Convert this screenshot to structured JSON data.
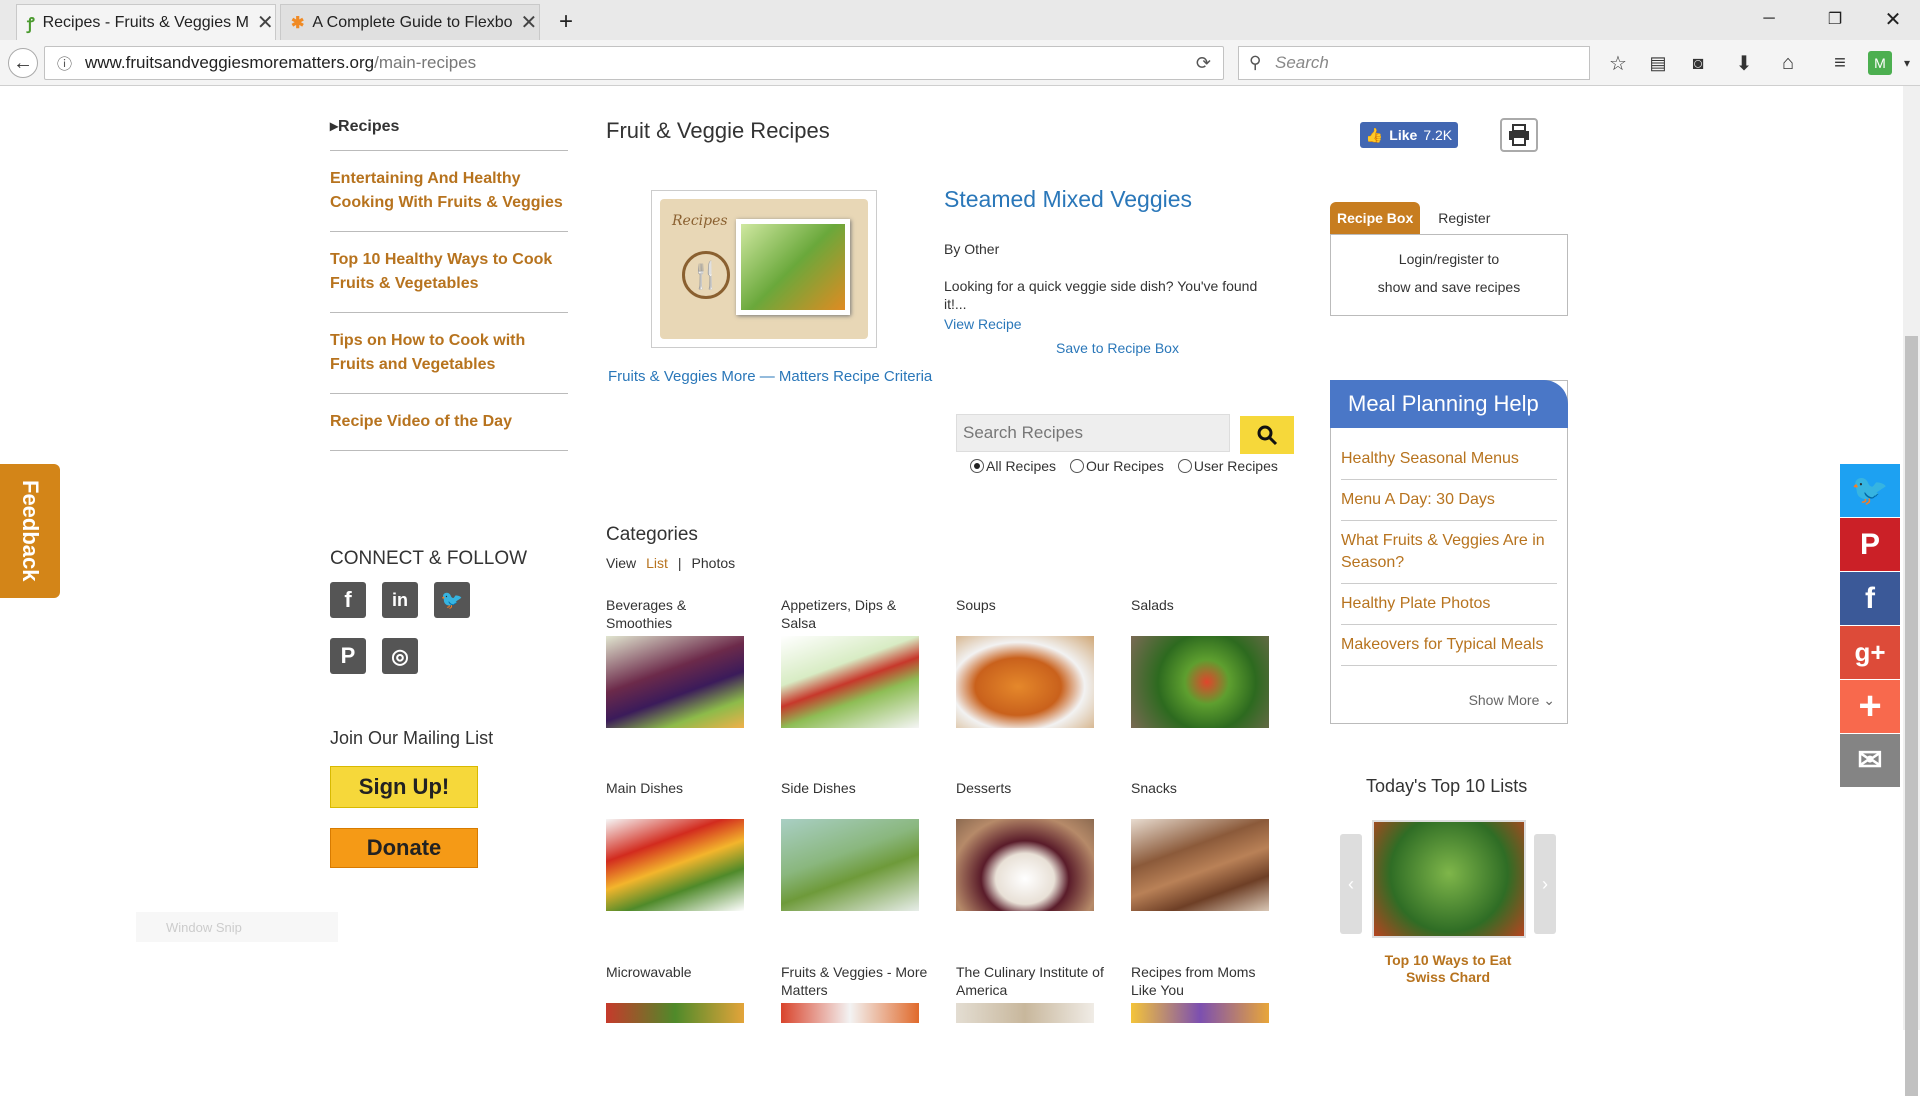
{
  "browser": {
    "tabs": [
      {
        "title": "Recipes - Fruits & Veggies M",
        "active": true
      },
      {
        "title": "A Complete Guide to Flexbo",
        "active": false
      }
    ],
    "new_tab": "+",
    "url_host": "www.fruitsandveggiesmorematters.org",
    "url_path": "/main-recipes",
    "search_placeholder": "Search"
  },
  "left_nav": {
    "head": "Recipes",
    "items": [
      "Entertaining And Healthy Cooking With Fruits & Veggies",
      "Top 10 Healthy Ways to Cook Fruits & Vegetables",
      "Tips on How to Cook with Fruits and Vegetables",
      "Recipe Video of the Day"
    ]
  },
  "connect": {
    "head": "CONNECT & FOLLOW",
    "icons": [
      "facebook-icon",
      "linkedin-icon",
      "twitter-icon",
      "pinterest-icon",
      "instagram-icon"
    ]
  },
  "mailing": {
    "head": "Join Our Mailing List",
    "signup": "Sign Up!",
    "donate": "Donate"
  },
  "feedback": "Feedback",
  "snip_label": "Window Snip",
  "main": {
    "title": "Fruit & Veggie Recipes",
    "recipe_card_script": "Recipes",
    "criteria_link": "Fruits & Veggies More — Matters Recipe Criteria",
    "featured": {
      "title": "Steamed Mixed Veggies",
      "by": "By Other",
      "desc": "Looking for a quick veggie side dish? You've found it!...",
      "view": "View Recipe",
      "save": "Save to Recipe Box"
    },
    "search_placeholder": "Search Recipes",
    "radios": [
      {
        "label": "All Recipes",
        "checked": true
      },
      {
        "label": "Our Recipes",
        "checked": false
      },
      {
        "label": "User Recipes",
        "checked": false
      }
    ],
    "categories_head": "Categories",
    "view_label": "View",
    "view_list": "List",
    "view_sep": "|",
    "view_photos": "Photos",
    "categories": [
      "Beverages & Smoothies",
      "Appetizers, Dips & Salsa",
      "Soups",
      "Salads",
      "Main Dishes",
      "Side Dishes",
      "Desserts",
      "Snacks",
      "Microwavable",
      "Fruits & Veggies - More Matters",
      "The Culinary Institute of America",
      "Recipes from Moms Like You"
    ]
  },
  "right": {
    "like": "Like",
    "like_count": "7.2K",
    "recipe_box_tab": "Recipe Box",
    "register_tab": "Register",
    "recipe_box_text_1": "Login/register to",
    "recipe_box_text_2": "show and save recipes",
    "meal_head": "Meal Planning Help",
    "meal_items": [
      "Healthy Seasonal Menus",
      "Menu A Day: 30 Days",
      "What Fruits & Veggies Are in Season?",
      "Healthy Plate Photos",
      "Makeovers for Typical Meals"
    ],
    "show_more": "Show More",
    "top10_head": "Today's Top 10 Lists",
    "top10_caption": "Top 10 Ways to Eat Swiss Chard"
  },
  "colors": {
    "accent_orange": "#b7731e",
    "link_blue": "#2a77b9",
    "meal_blue": "#4a77c7",
    "twitter": "#1da1f2",
    "pinterest": "#cb2027",
    "facebook": "#3b5998",
    "googleplus": "#dd4b39",
    "addthis": "#f8694d",
    "email": "#848484"
  }
}
